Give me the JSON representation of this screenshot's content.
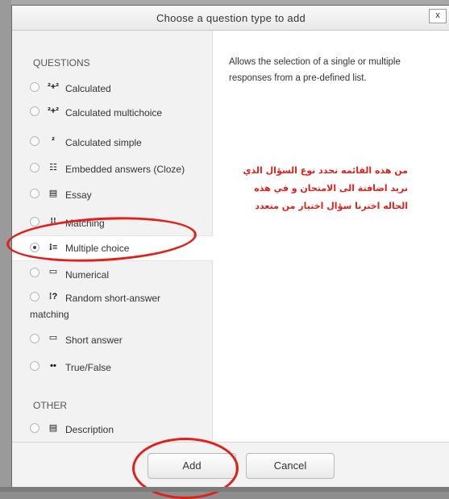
{
  "dialog": {
    "title": "Choose a question type to add",
    "close_label": "x"
  },
  "left": {
    "questions_heading": "QUESTIONS",
    "other_heading": "OTHER",
    "questions": [
      {
        "label": "Calculated",
        "icon": "calculated-icon",
        "glyph": "²+²"
      },
      {
        "label": "Calculated multichoice",
        "icon": "calculated-multichoice-icon",
        "glyph": "²+²"
      },
      {
        "label": "Calculated simple",
        "icon": "calculated-simple-icon",
        "glyph": "²"
      },
      {
        "label": "Embedded answers (Cloze)",
        "icon": "cloze-icon",
        "glyph": "☷"
      },
      {
        "label": "Essay",
        "icon": "essay-icon",
        "glyph": "▤"
      },
      {
        "label": "Matching",
        "icon": "matching-icon",
        "glyph": "⁞⁞"
      },
      {
        "label": "Multiple choice",
        "icon": "multiple-choice-icon",
        "glyph": "⁝≡",
        "selected": true
      },
      {
        "label": "Numerical",
        "icon": "numerical-icon",
        "glyph": "▭"
      },
      {
        "label": "Random short-answer",
        "label_line2": "matching",
        "icon": "random-short-answer-icon",
        "glyph": "⁞?"
      },
      {
        "label": "Short answer",
        "icon": "short-answer-icon",
        "glyph": "▭"
      },
      {
        "label": "True/False",
        "icon": "true-false-icon",
        "glyph": "••"
      }
    ],
    "other": [
      {
        "label": "Description",
        "icon": "description-icon",
        "glyph": "▤"
      }
    ]
  },
  "right": {
    "description": "Allows the selection of a single or multiple responses from a pre-defined list.",
    "annotation_lines": [
      "من هذه القائمه نحدد نوع السؤال الذي",
      "نريد اضافتة الى الامتحان و في هذه",
      "الحاله اخترنا سؤال اختيار من متعدد"
    ]
  },
  "footer": {
    "add_label": "Add",
    "cancel_label": "Cancel"
  },
  "colors": {
    "annotation": "#e0201a"
  }
}
